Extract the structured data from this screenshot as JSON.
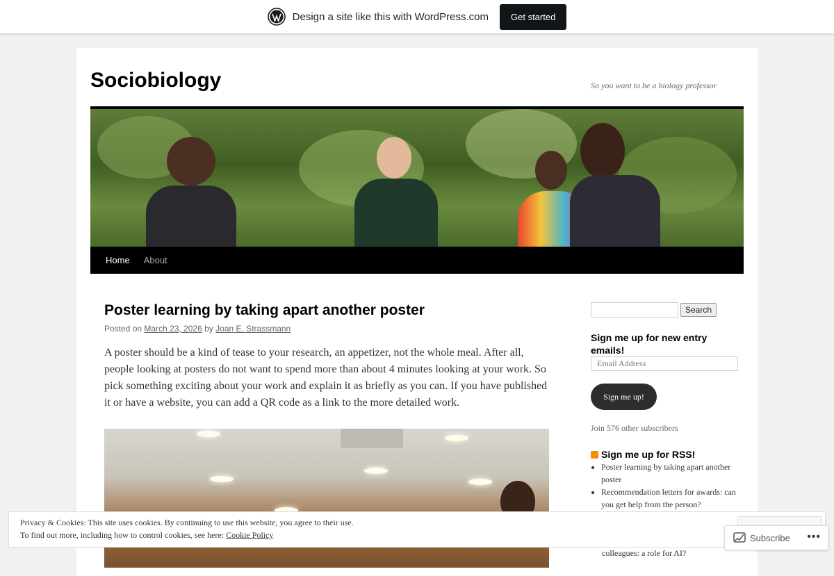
{
  "wpbar": {
    "text": "Design a site like this with WordPress.com",
    "button": "Get started"
  },
  "site": {
    "title": "Sociobiology",
    "description": "So you want to be a biology professor"
  },
  "nav": {
    "items": [
      "Home",
      "About"
    ]
  },
  "post": {
    "title": "Poster learning by taking apart another poster",
    "posted_on_label": "Posted on",
    "date": "March 23, 2026",
    "by_label": "by",
    "author": "Joan E. Strassmann",
    "body": "A poster should be a kind of tease to your research, an appetizer, not the whole meal. After all, people looking at posters do not want to spend more than about 4 minutes looking at your work. So pick something exciting about your work and explain it as briefly as you can. If you have published it or have a website, you can add a QR code as a link to the more detailed work."
  },
  "sidebar": {
    "search_button": "Search",
    "email_heading": "Sign me up for new entry emails!",
    "email_placeholder": "Email Address",
    "signup_button": "Sign me up!",
    "subscribers": "Join 576 other subscribers",
    "rss_heading": "Sign me up for RSS!",
    "rss_items": [
      "Poster learning by taking apart another poster",
      "Recommendation letters for awards: can you get help from the person?"
    ],
    "partial_item": "colleagues: a role for AI?"
  },
  "cookie": {
    "line1": "Privacy & Cookies: This site uses cookies. By continuing to use this website, you agree to their use.",
    "line2_prefix": "To find out more, including how to control cookies, see here:",
    "line2_link": "Cookie Policy"
  },
  "subscribe": {
    "label": "Subscribe",
    "more": "•••"
  }
}
